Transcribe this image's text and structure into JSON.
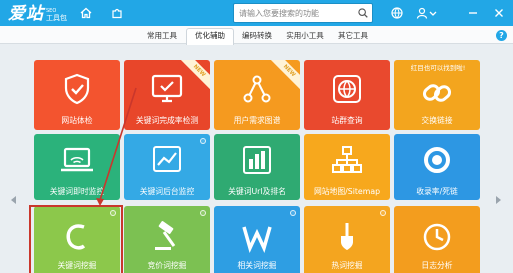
{
  "app": {
    "logo_main": "爱站",
    "logo_seo": "SEO",
    "logo_sub": "工具包",
    "title_icons": [
      "home-icon",
      "puzzle-icon"
    ],
    "right_icons": [
      "globe-icon",
      "user-icon",
      "chevron-down-icon",
      "minimize-icon",
      "close-icon"
    ]
  },
  "search": {
    "placeholder": "请输入您要搜索的功能",
    "icon": "search-icon"
  },
  "tabs": [
    "常用工具",
    "优化辅助",
    "编码转换",
    "实用小工具",
    "其它工具"
  ],
  "active_tab": "优化辅助",
  "help_label": "?",
  "tiles": {
    "row1": [
      {
        "label": "网站体检",
        "color": "#f3542f",
        "icon": "shield-check-icon"
      },
      {
        "label": "关键词完成率检测",
        "color": "#e8462a",
        "icon": "monitor-check-icon",
        "badge": "NEW"
      },
      {
        "label": "用户需求图谱",
        "color": "#f59a1f",
        "icon": "graph-nodes-icon",
        "badge": "NEW"
      },
      {
        "label": "站群查询",
        "color": "#e9492e",
        "icon": "globe-box-icon"
      },
      {
        "label": "交换链接",
        "color": "#f3a51e",
        "icon": "link-icon",
        "note": "红目也可以找到啦!"
      }
    ],
    "row2": [
      {
        "label": "关键词即时监控",
        "color": "#2bb27b",
        "icon": "laptop-wifi-icon"
      },
      {
        "label": "关键词后台监控",
        "color": "#34a9e5",
        "icon": "trend-chart-icon"
      },
      {
        "label": "关键词Url及排名",
        "color": "#2faa72",
        "icon": "bar-chart-icon"
      },
      {
        "label": "网站地图/Sitemap",
        "color": "#f7a81d",
        "icon": "sitemap-icon"
      },
      {
        "label": "收录率/死链",
        "color": "#2d97e3",
        "icon": "ring-icon"
      }
    ],
    "row3": [
      {
        "label": "关键词挖掘",
        "color": "#8cc84b",
        "icon": "c-letter-icon"
      },
      {
        "label": "竞价词挖掘",
        "color": "#7cc152",
        "icon": "gavel-icon"
      },
      {
        "label": "相关词挖掘",
        "color": "#2e9ee3",
        "icon": "w-letter-icon"
      },
      {
        "label": "热词挖掘",
        "color": "#f4a51f",
        "icon": "shovel-icon"
      },
      {
        "label": "日志分析",
        "color": "#f39d1e",
        "icon": "clock-icon"
      }
    ]
  }
}
